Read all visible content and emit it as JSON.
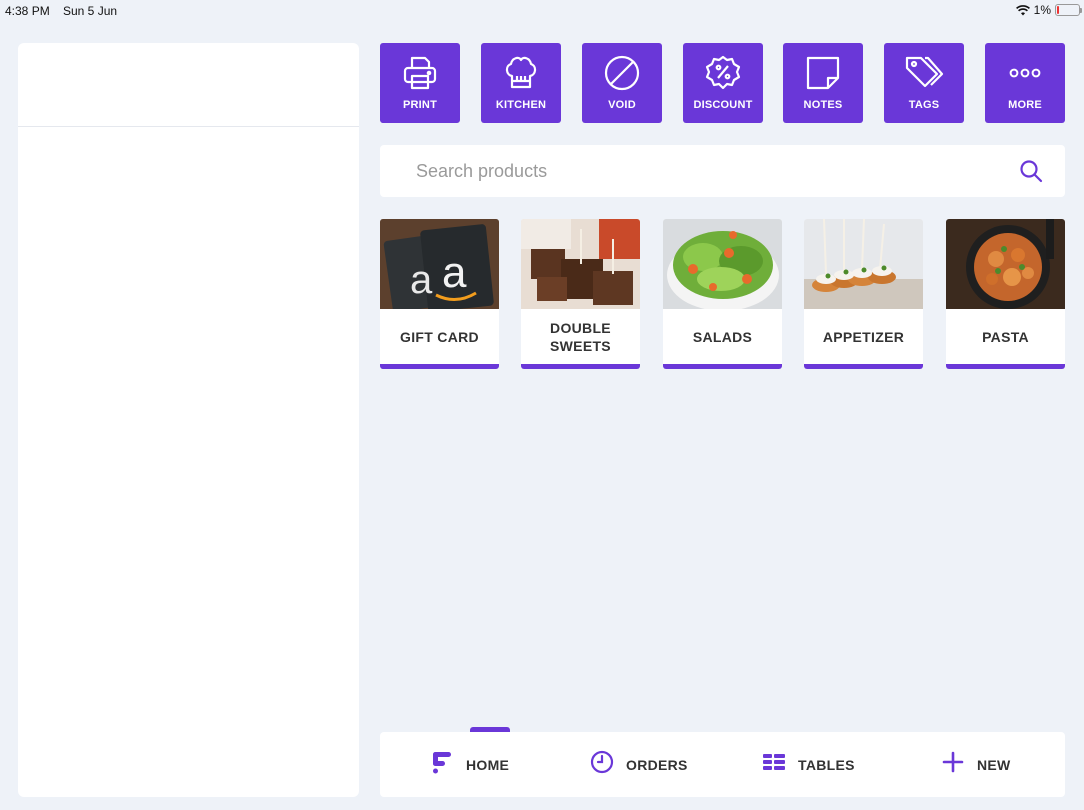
{
  "status_bar": {
    "time": "4:38 PM",
    "date": "Sun 5 Jun",
    "battery": "1%"
  },
  "actions": [
    {
      "label": "PRINT",
      "icon": "printer-icon"
    },
    {
      "label": "KITCHEN",
      "icon": "chef-hat-icon"
    },
    {
      "label": "VOID",
      "icon": "void-icon"
    },
    {
      "label": "DISCOUNT",
      "icon": "discount-icon"
    },
    {
      "label": "NOTES",
      "icon": "note-icon"
    },
    {
      "label": "TAGS",
      "icon": "tags-icon"
    },
    {
      "label": "MORE",
      "icon": "more-icon"
    }
  ],
  "search": {
    "placeholder": "Search products",
    "value": ""
  },
  "categories": [
    {
      "name": "GIFT CARD",
      "image": "gift-card-image"
    },
    {
      "name": "DOUBLE SWEETS",
      "image": "sweets-image"
    },
    {
      "name": "SALADS",
      "image": "salad-image"
    },
    {
      "name": "APPETIZER",
      "image": "appetizer-image"
    },
    {
      "name": "PASTA",
      "image": "pasta-image"
    }
  ],
  "bottom_nav": [
    {
      "label": "HOME",
      "icon": "home-icon",
      "active": true
    },
    {
      "label": "ORDERS",
      "icon": "clock-icon",
      "active": false
    },
    {
      "label": "TABLES",
      "icon": "tables-icon",
      "active": false
    },
    {
      "label": "NEW",
      "icon": "plus-icon",
      "active": false
    }
  ],
  "colors": {
    "accent": "#6a37d8",
    "background": "#eef2f8",
    "panel": "#ffffff"
  }
}
